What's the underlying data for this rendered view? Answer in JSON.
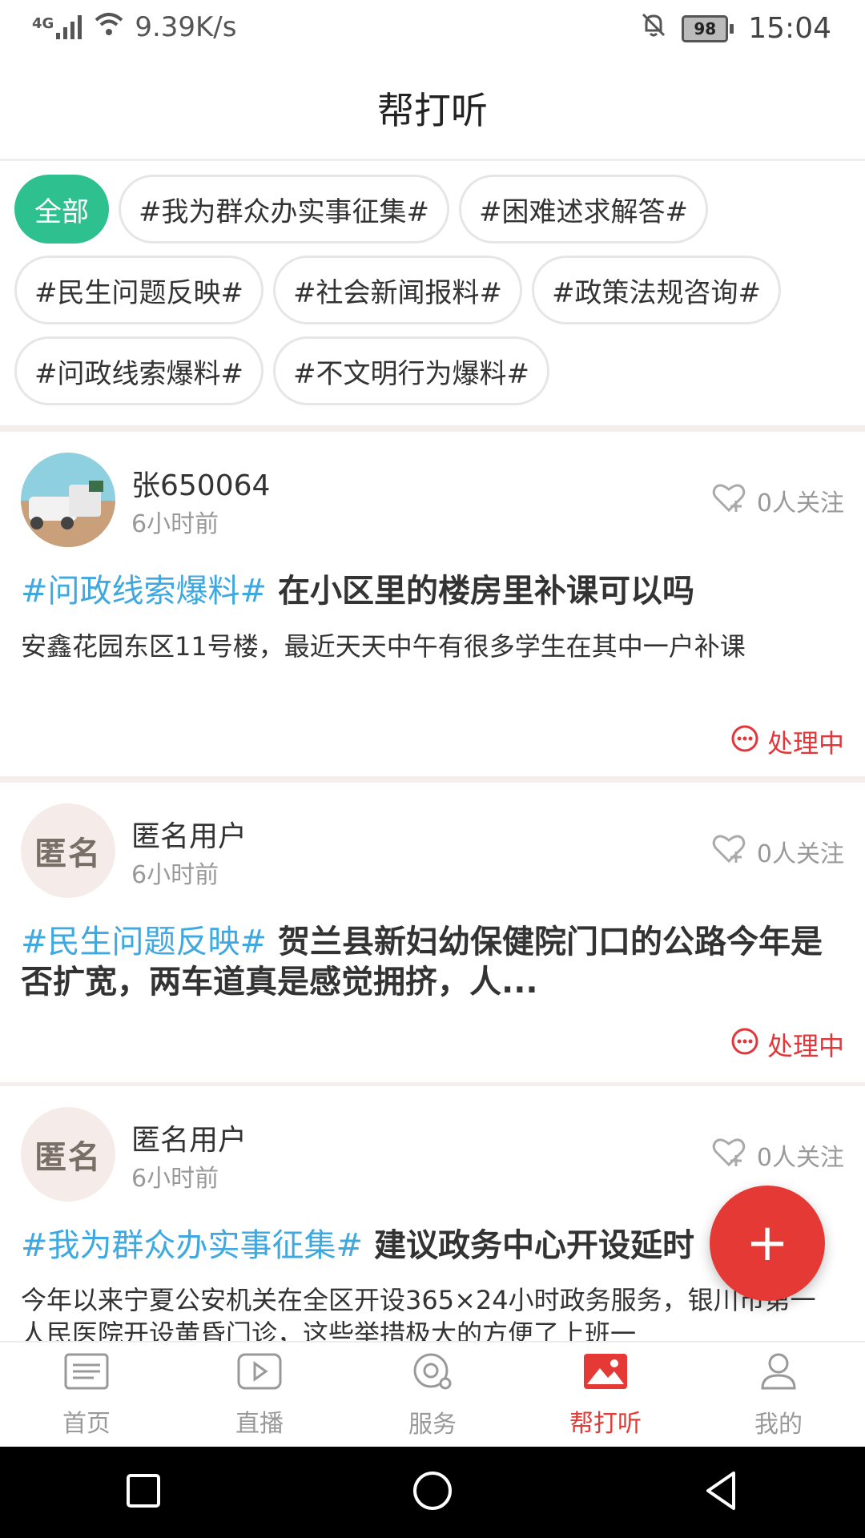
{
  "status_bar": {
    "network": "4G",
    "speed": "9.39K/s",
    "battery": "98",
    "time": "15:04"
  },
  "header": {
    "title": "帮打听"
  },
  "tags": [
    {
      "label": "全部",
      "active": true
    },
    {
      "label": "#我为群众办实事征集#",
      "active": false
    },
    {
      "label": "#困难述求解答#",
      "active": false
    },
    {
      "label": "#民生问题反映#",
      "active": false
    },
    {
      "label": "#社会新闻报料#",
      "active": false
    },
    {
      "label": "#政策法规咨询#",
      "active": false
    },
    {
      "label": "#问政线索爆料#",
      "active": false
    },
    {
      "label": "#不文明行为爆料#",
      "active": false
    }
  ],
  "posts": [
    {
      "user": "张650064",
      "time": "6小时前",
      "followers": "0人关注",
      "hashtag": "#问政线索爆料#",
      "title": "在小区里的楼房里补课可以吗",
      "body": "安鑫花园东区11号楼，最近天天中午有很多学生在其中一户补课",
      "status": "处理中"
    },
    {
      "user": "匿名用户",
      "avatar_text": "匿名",
      "time": "6小时前",
      "followers": "0人关注",
      "hashtag": "#民生问题反映#",
      "title": "贺兰县新妇幼保健院门口的公路今年是否扩宽，两车道真是感觉拥挤，人...",
      "status": "处理中"
    },
    {
      "user": "匿名用户",
      "avatar_text": "匿名",
      "time": "6小时前",
      "followers": "0人关注",
      "hashtag": "#我为群众办实事征集#",
      "title": "建议政务中心开设延时",
      "body": "今年以来宁夏公安机关在全区开设365×24小时政务服务，银川市第一人民医院开设黄昏门诊，这些举措极大的方便了上班一"
    }
  ],
  "fab": {
    "label": "+"
  },
  "tabbar": [
    {
      "label": "首页",
      "icon": "home-list-icon",
      "active": false
    },
    {
      "label": "直播",
      "icon": "play-icon",
      "active": false
    },
    {
      "label": "服务",
      "icon": "service-icon",
      "active": false
    },
    {
      "label": "帮打听",
      "icon": "picture-icon",
      "active": true
    },
    {
      "label": "我的",
      "icon": "person-icon",
      "active": false
    }
  ],
  "colors": {
    "accent_green": "#2fc08f",
    "accent_red": "#e53935",
    "hashtag_blue": "#3ea8e0"
  }
}
